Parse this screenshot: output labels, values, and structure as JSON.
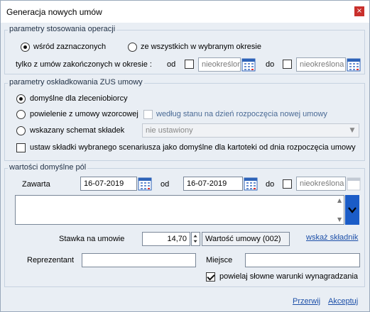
{
  "window": {
    "title": "Generacja nowych umów",
    "close_glyph": "×"
  },
  "ops": {
    "group_title": "parametry stosowania operacji",
    "radio_selected": "wśród zaznaczonych",
    "radio_all": "ze wszystkich w wybranym okresie",
    "ended_only": "tylko z umów zakończonych  w okresie :",
    "from_label": "od",
    "from_value": "nieokreślon",
    "to_label": "do",
    "to_value": "nieokreślona"
  },
  "zus": {
    "group_title": "parametry oskładkowania ZUS umowy",
    "opt_default": "domyślne dla zleceniobiorcy",
    "opt_copy": "powielenie z umowy wzorcowej",
    "per_state": "według stanu na dzień rozpoczęcia nowej umowy",
    "opt_scheme": "wskazany schemat składek",
    "scheme_value": "nie ustawiony",
    "set_default": "ustaw składki wybranego scenariusza jako domyślne dla kartoteki od dnia rozpoczęcia umowy"
  },
  "defaults": {
    "group_title": "wartości domyślne pól",
    "zawarta_label": "Zawarta",
    "zawarta_value": "16-07-2019",
    "od_label": "od",
    "od_value": "16-07-2019",
    "do_label": "do",
    "do_value": "nieokreślona",
    "rate_label": "Stawka na umowie",
    "rate_value": "14,70",
    "contract_value_label": "Wartość umowy (002)",
    "show_component": "wskaż składnik",
    "rep_label": "Reprezentant",
    "rep_value": "",
    "place_label": "Miejsce",
    "place_value": "",
    "copy_verbal": "powielaj słowne warunki wynagradzania"
  },
  "footer": {
    "cancel": "Przerwij",
    "accept": "Akceptuj"
  },
  "colors": {
    "accent": "#1b5cc7",
    "link": "#1c4fa8",
    "close": "#c9302c"
  }
}
